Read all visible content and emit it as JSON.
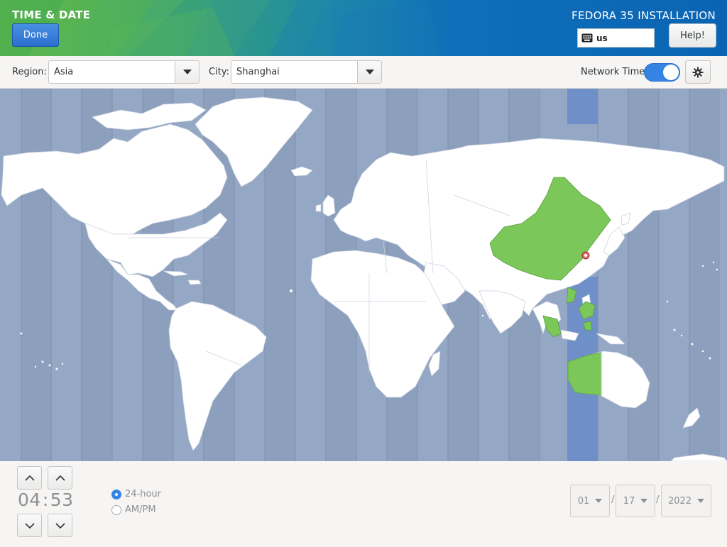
{
  "header": {
    "title": "TIME & DATE",
    "done_label": "Done",
    "product": "FEDORA 35 INSTALLATION",
    "keyboard_layout": "us",
    "help_label": "Help!"
  },
  "toolbar": {
    "region_label": "Region:",
    "region_value": "Asia",
    "city_label": "City:",
    "city_value": "Shanghai",
    "network_time_label": "Network Time",
    "network_time_on": true
  },
  "time": {
    "hours": "04",
    "separator": ":",
    "minutes": "53",
    "format_24": "24-hour",
    "format_ampm": "AM/PM",
    "selected_format": "24-hour"
  },
  "date": {
    "month": "01",
    "day": "17",
    "year": "2022",
    "separator": "/"
  },
  "colors": {
    "ocean": "#94a7c4",
    "land": "#ffffff",
    "selected_zone_land": "#7bc75a",
    "selected_zone_band": "#6f8fc9",
    "accent": "#3584e4"
  }
}
